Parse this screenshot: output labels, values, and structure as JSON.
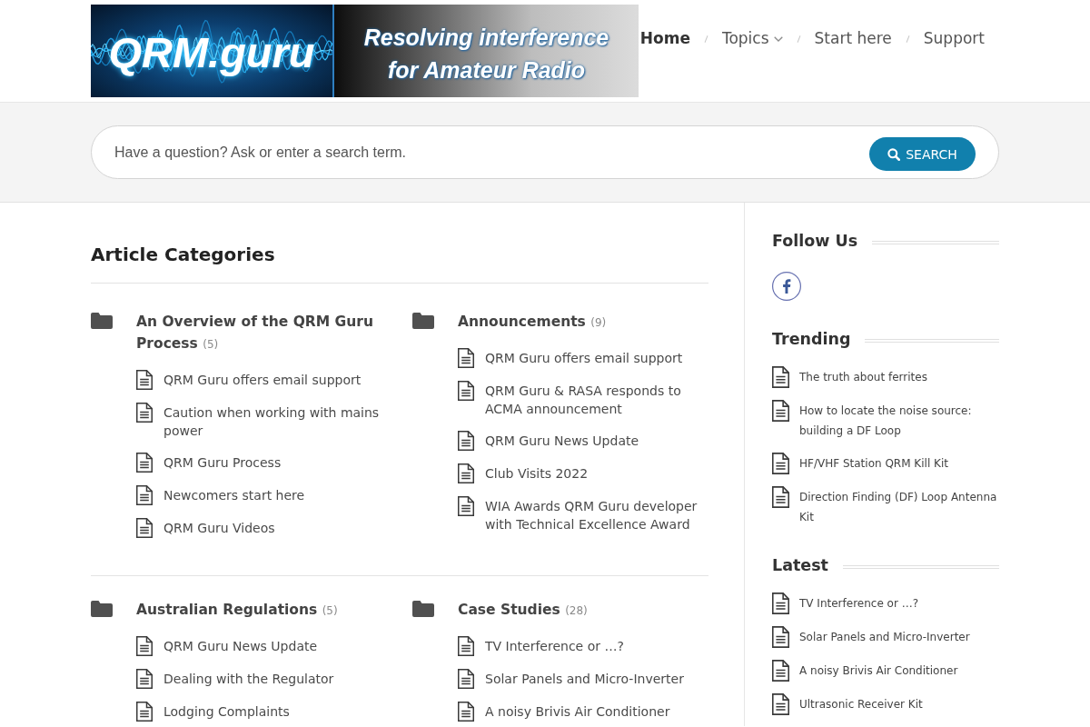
{
  "header": {
    "logo": {
      "title": "QRM.guru",
      "tagline": "Resolving interference for Amateur Radio"
    },
    "nav": [
      {
        "label": "Home",
        "selected": true,
        "has_menu": false
      },
      {
        "label": "Topics",
        "selected": false,
        "has_menu": true
      },
      {
        "label": "Start here",
        "selected": false,
        "has_menu": false
      },
      {
        "label": "Support",
        "selected": false,
        "has_menu": false
      }
    ]
  },
  "search": {
    "placeholder": "Have a question? Ask or enter a search term.",
    "button": "SEARCH"
  },
  "main": {
    "title": "Article Categories",
    "categories": [
      {
        "title": "An Overview of the QRM Guru Process",
        "count": "(5)",
        "articles": [
          "QRM Guru offers email support",
          "Caution when working with mains power",
          "QRM Guru Process",
          "Newcomers start here",
          "QRM Guru Videos"
        ]
      },
      {
        "title": "Announcements",
        "count": "(9)",
        "articles": [
          "QRM Guru offers email support",
          "QRM Guru & RASA responds to ACMA announcement",
          "QRM Guru News Update",
          "Club Visits 2022",
          "WIA Awards QRM Guru developer with Technical Excellence Award"
        ]
      },
      {
        "title": "Australian Regulations",
        "count": "(5)",
        "articles": [
          "QRM Guru News Update",
          "Dealing with the Regulator",
          "Lodging Complaints"
        ]
      },
      {
        "title": "Case Studies",
        "count": "(28)",
        "articles": [
          "TV Interference or …?",
          "Solar Panels and Micro-Inverter",
          "A noisy Brivis Air Conditioner"
        ]
      }
    ]
  },
  "sidebar": {
    "sections": [
      {
        "kind": "social",
        "title": "Follow Us"
      },
      {
        "kind": "articles",
        "title": "Trending",
        "articles": [
          "The truth about ferrites",
          "How to locate the noise source: building a DF Loop",
          "HF/VHF Station QRM Kill Kit",
          "Direction Finding (DF) Loop Antenna Kit"
        ]
      },
      {
        "kind": "articles",
        "title": "Latest",
        "articles": [
          "TV Interference or …?",
          "Solar Panels and Micro-Inverter",
          "A noisy Brivis Air Conditioner",
          "Ultrasonic Receiver Kit"
        ]
      }
    ]
  }
}
